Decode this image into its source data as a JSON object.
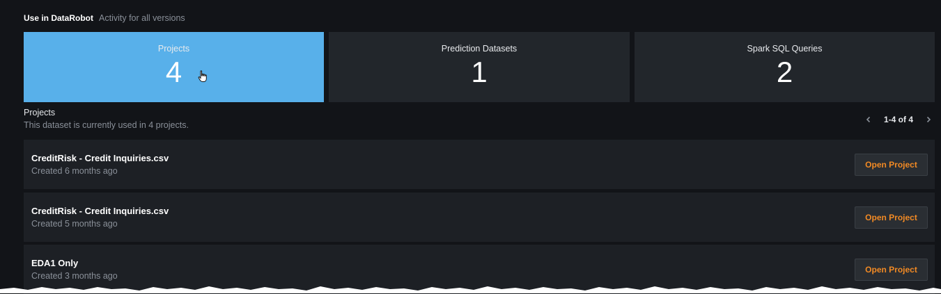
{
  "header": {
    "title": "Use in DataRobot",
    "subtitle": "Activity for all versions"
  },
  "tiles": [
    {
      "label": "Projects",
      "value": "4",
      "active": true
    },
    {
      "label": "Prediction Datasets",
      "value": "1",
      "active": false
    },
    {
      "label": "Spark SQL Queries",
      "value": "2",
      "active": false
    }
  ],
  "section": {
    "title": "Projects",
    "description": "This dataset is currently used in 4 projects."
  },
  "pager": {
    "range": "1-4 of 4",
    "prev_icon": "chevron-left-icon",
    "next_icon": "chevron-right-icon"
  },
  "projects": [
    {
      "name": "CreditRisk - Credit Inquiries.csv",
      "created": "Created 6 months ago",
      "action": "Open Project"
    },
    {
      "name": "CreditRisk - Credit Inquiries.csv",
      "created": "Created 5 months ago",
      "action": "Open Project"
    },
    {
      "name": "EDA1 Only",
      "created": "Created 3 months ago",
      "action": "Open Project"
    }
  ],
  "colors": {
    "background": "#121418",
    "tile": "#22262b",
    "tile_active": "#58b0ea",
    "row": "#1d2025",
    "action_text": "#f28a24"
  }
}
